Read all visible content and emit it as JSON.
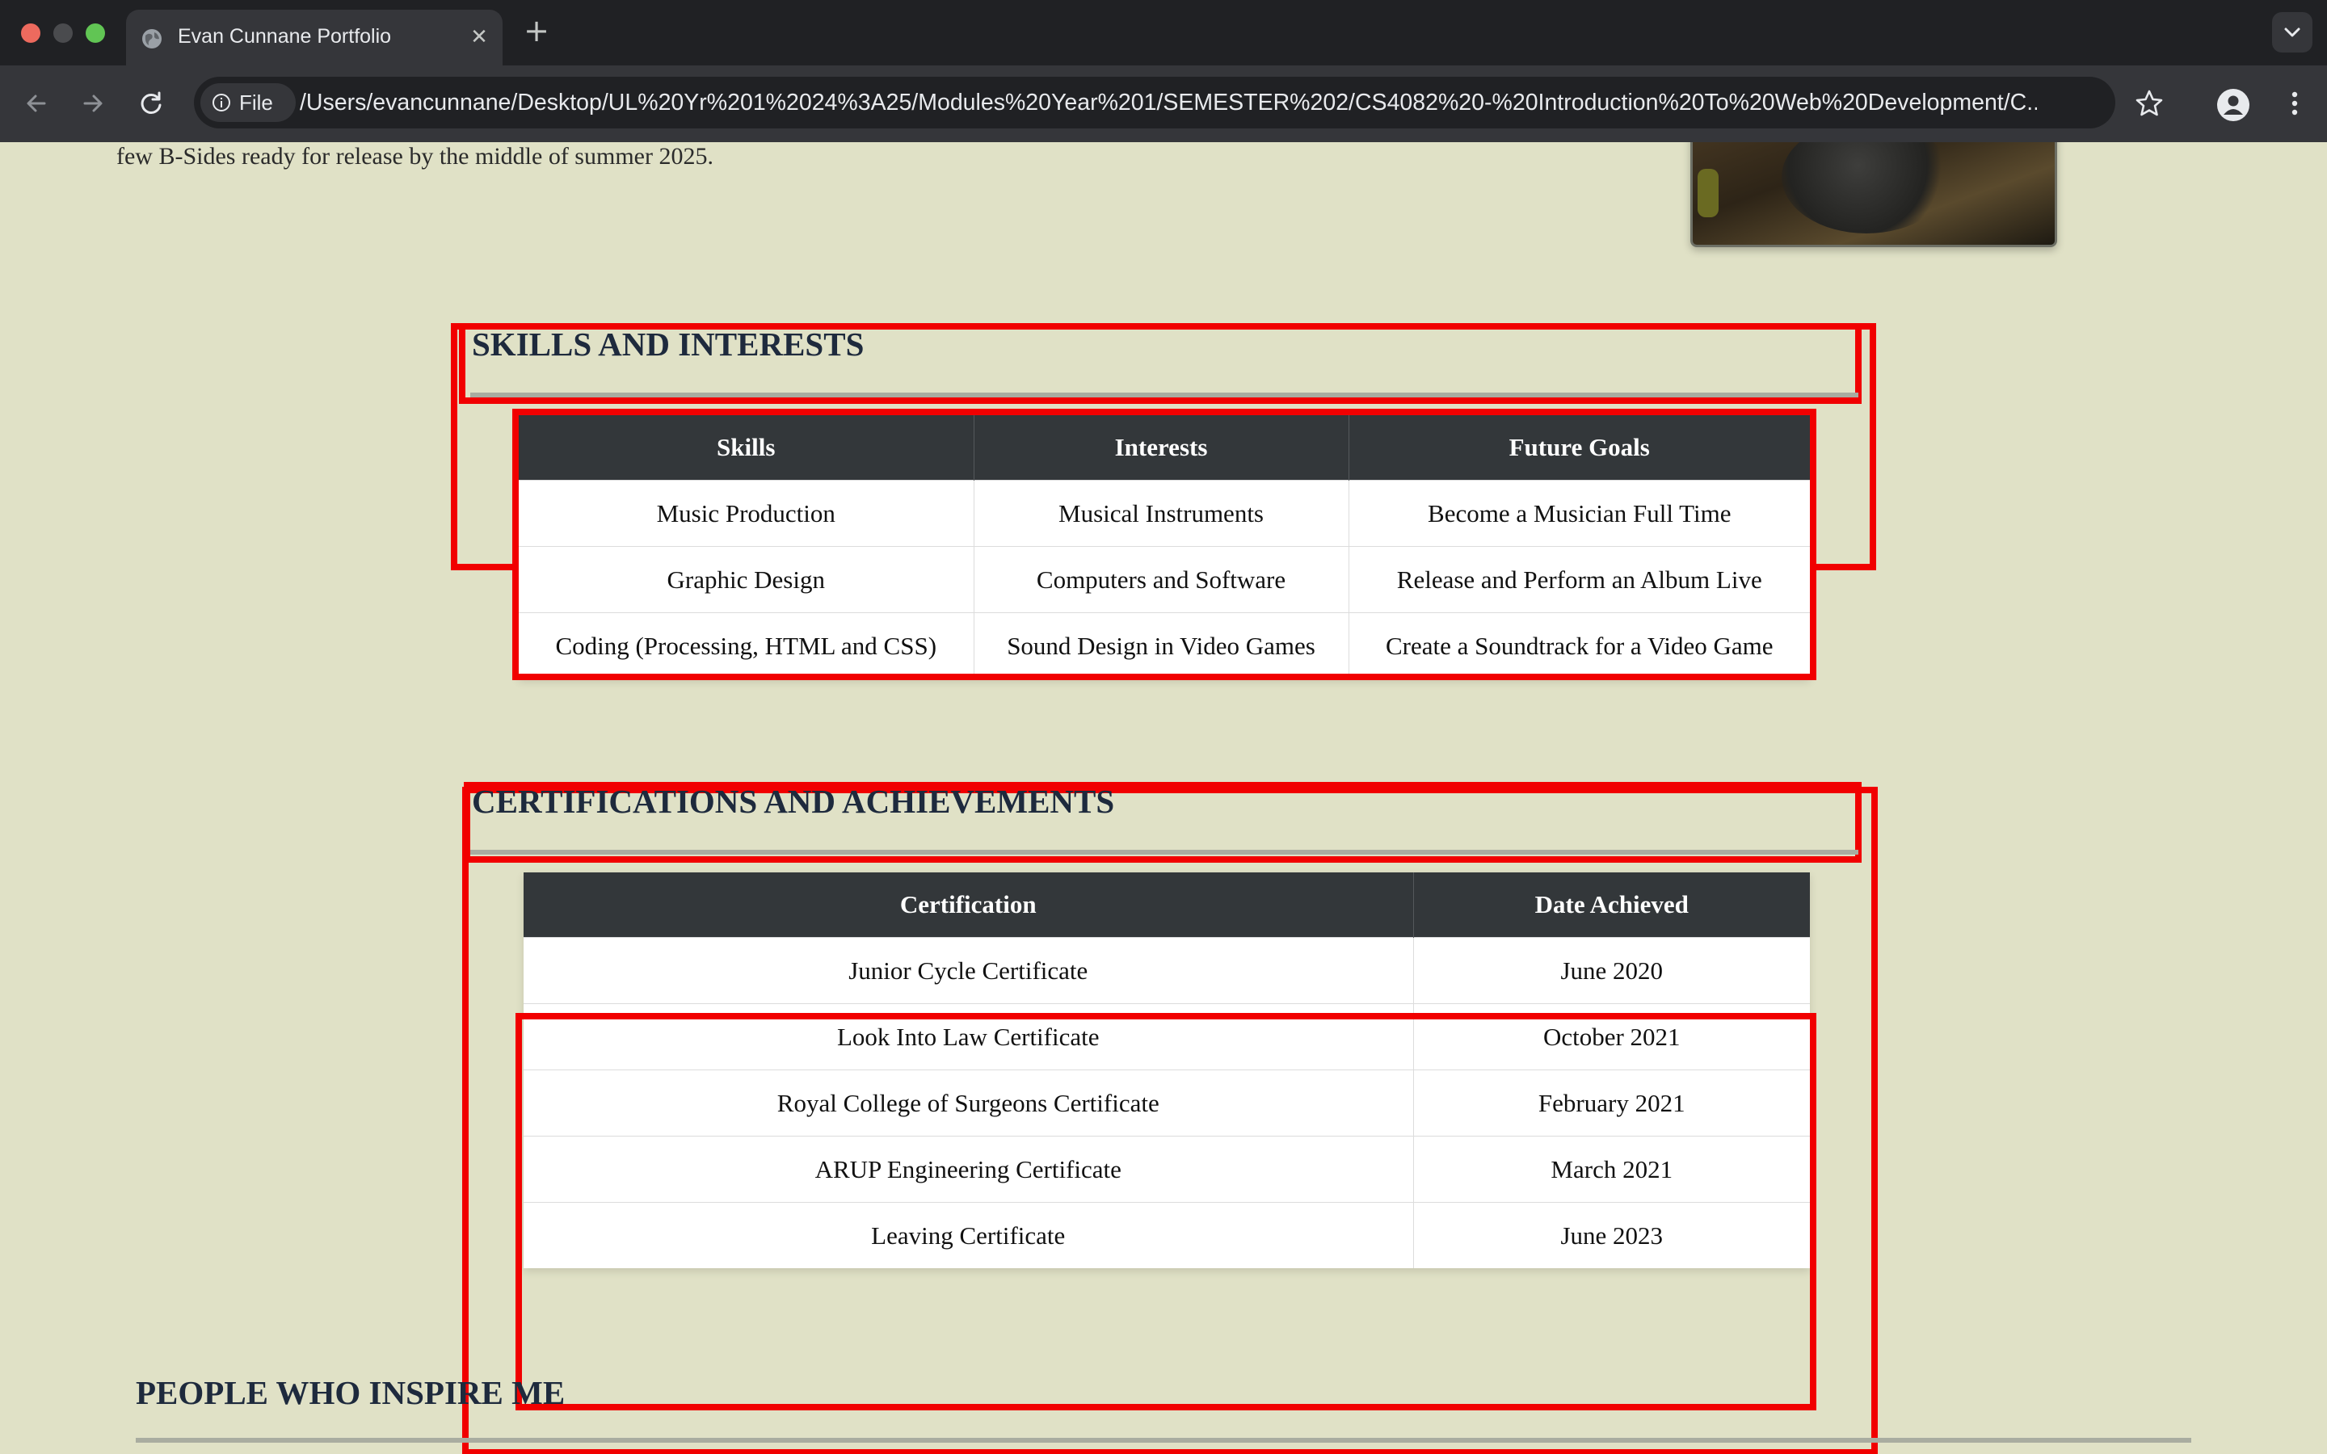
{
  "browser": {
    "tab_title": "Evan Cunnane Portfolio",
    "site_chip_label": "File",
    "url": "/Users/evancunnane/Desktop/UL%20Yr%201%2024%3A25/Modules%20Year%201/SEMESTER%202/CS4082%20-%20Introduction%20To%20Web%20Development/C..."
  },
  "page": {
    "intro_tail": "few B-Sides ready for release by the middle of summer 2025.",
    "skills_section": {
      "title": "SKILLS AND INTERESTS",
      "headers": [
        "Skills",
        "Interests",
        "Future Goals"
      ],
      "rows": [
        [
          "Music Production",
          "Musical Instruments",
          "Become a Musician Full Time"
        ],
        [
          "Graphic Design",
          "Computers and Software",
          "Release and Perform an Album Live"
        ],
        [
          "Coding (Processing, HTML and CSS)",
          "Sound Design in Video Games",
          "Create a Soundtrack for a Video Game"
        ]
      ]
    },
    "certs_section": {
      "title": "CERTIFICATIONS AND ACHIEVEMENTS",
      "headers": [
        "Certification",
        "Date Achieved"
      ],
      "rows": [
        [
          "Junior Cycle Certificate",
          "June 2020"
        ],
        [
          "Look Into Law Certificate",
          "October 2021"
        ],
        [
          "Royal College of Surgeons Certificate",
          "February 2021"
        ],
        [
          "ARUP Engineering Certificate",
          "March 2021"
        ],
        [
          "Leaving Certificate",
          "June 2023"
        ]
      ]
    },
    "inspire_section": {
      "title": "PEOPLE WHO INSPIRE ME"
    }
  },
  "colors": {
    "page_background": "#e0e1c6",
    "heading": "#1e2a3d",
    "table_header": "#33373a",
    "highlight_box": "#f10000"
  }
}
